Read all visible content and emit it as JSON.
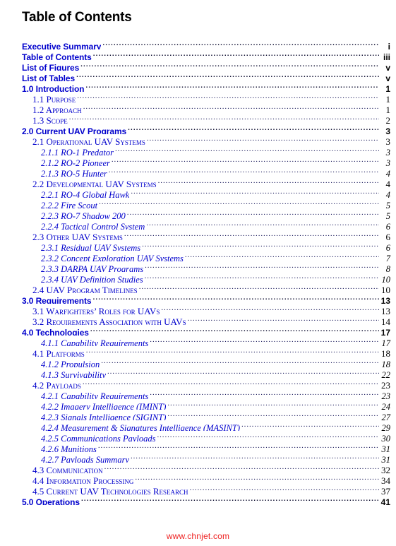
{
  "document": {
    "title": "Table of Contents",
    "link_color": "#0000CC",
    "text_color": "#000000",
    "background_color": "#FFFFFF",
    "watermark": "www.chnjet.com",
    "watermark_color": "#EE2222"
  },
  "toc": {
    "entries": [
      {
        "level": 1,
        "label": "Executive Summary",
        "page": "i"
      },
      {
        "level": 1,
        "label": "Table of Contents",
        "page": "iii"
      },
      {
        "level": 1,
        "label": "List of Figures",
        "page": "v"
      },
      {
        "level": 1,
        "label": "List of Tables",
        "page": "v"
      },
      {
        "level": 1,
        "label": "1.0 Introduction",
        "page": "1"
      },
      {
        "level": 2,
        "label": "1.1 Purpose",
        "page": "1"
      },
      {
        "level": 2,
        "label": "1.2 Approach",
        "page": "1"
      },
      {
        "level": 2,
        "label": "1.3 Scope",
        "page": "2"
      },
      {
        "level": 1,
        "label": "2.0 Current UAV Programs",
        "page": "3"
      },
      {
        "level": 2,
        "label": "2.1 Operational UAV Systems",
        "page": "3"
      },
      {
        "level": 3,
        "label": "2.1.1 RQ-1 Predator",
        "page": "3"
      },
      {
        "level": 3,
        "label": "2.1.2 RQ-2 Pioneer",
        "page": "3"
      },
      {
        "level": 3,
        "label": "2.1.3 RQ-5 Hunter",
        "page": "4"
      },
      {
        "level": 2,
        "label": "2.2 Developmental UAV Systems",
        "page": "4"
      },
      {
        "level": 3,
        "label": "2.2.1 RQ-4 Global Hawk",
        "page": "4"
      },
      {
        "level": 3,
        "label": "2.2.2 Fire Scout",
        "page": "5"
      },
      {
        "level": 3,
        "label": "2.2.3 RQ-7 Shadow 200",
        "page": "5"
      },
      {
        "level": 3,
        "label": "2.2.4 Tactical Control System",
        "page": "6"
      },
      {
        "level": 2,
        "label": "2.3 Other UAV Systems",
        "page": "6"
      },
      {
        "level": 3,
        "label": "2.3.1 Residual UAV Systems",
        "page": "6"
      },
      {
        "level": 3,
        "label": "2.3.2 Concept Exploration UAV Systems",
        "page": "7"
      },
      {
        "level": 3,
        "label": "2.3.3 DARPA UAV Programs",
        "page": "8"
      },
      {
        "level": 3,
        "label": "2.3.4 UAV Definition Studies",
        "page": "10"
      },
      {
        "level": 2,
        "label": "2.4 UAV Program Timelines",
        "page": "10"
      },
      {
        "level": 1,
        "label": "3.0 Requirements",
        "page": "13"
      },
      {
        "level": 2,
        "label": "3.1 Warfighters’ Roles for UAVs",
        "page": "13"
      },
      {
        "level": 2,
        "label": "3.2 Requirements Association with UAVs",
        "page": "14"
      },
      {
        "level": 1,
        "label": "4.0 Technologies",
        "page": "17"
      },
      {
        "level": 3,
        "label": "4.1.1 Capability Requirements",
        "page": "17"
      },
      {
        "level": 2,
        "label": "4.1 Platforms",
        "page": "18"
      },
      {
        "level": 3,
        "label": "4.1.2 Propulsion",
        "page": "18"
      },
      {
        "level": 3,
        "label": "4.1.3 Survivability",
        "page": "22"
      },
      {
        "level": 2,
        "label": "4.2 Payloads",
        "page": "23"
      },
      {
        "level": 3,
        "label": "4.2.1 Capability Requirements",
        "page": "23"
      },
      {
        "level": 3,
        "label": "4.2.2 Imagery Intelligence (IMINT)",
        "page": "24"
      },
      {
        "level": 3,
        "label": "4.2.3 Signals Intelligence (SIGINT)",
        "page": "27"
      },
      {
        "level": 3,
        "label": "4.2.4 Measurement & Signatures Intelligence (MASINT)",
        "page": "29"
      },
      {
        "level": 3,
        "label": "4.2.5 Communications Payloads",
        "page": "30"
      },
      {
        "level": 3,
        "label": "4.2.6 Munitions",
        "page": "31"
      },
      {
        "level": 3,
        "label": "4.2.7 Payloads Summary",
        "page": "31"
      },
      {
        "level": 2,
        "label": "4.3 Communication",
        "page": "32"
      },
      {
        "level": 2,
        "label": "4.4 Information Processing",
        "page": "34"
      },
      {
        "level": 2,
        "label": "4.5 Current UAV Technologies Research",
        "page": "37"
      },
      {
        "level": 1,
        "label": "5.0 Operations",
        "page": "41"
      }
    ]
  }
}
